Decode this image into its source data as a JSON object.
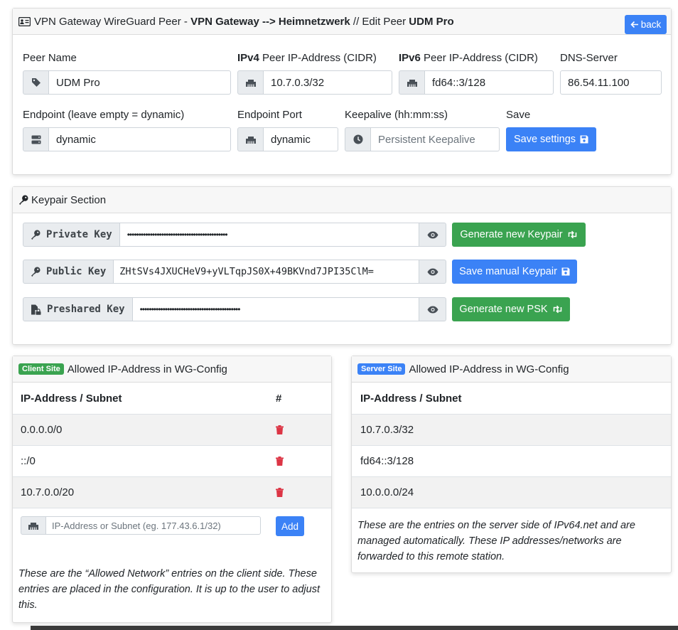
{
  "peer_card": {
    "title_prefix": "VPN Gateway WireGuard Peer - ",
    "title_gateway": "VPN Gateway --> Heimnetzwerk",
    "title_sep": " // Edit Peer ",
    "title_peer": "UDM Pro",
    "back_label": "back",
    "labels": {
      "peer_name": "Peer Name",
      "ipv4_bold": "IPv4",
      "ipv4_rest": " Peer IP-Address (CIDR)",
      "ipv6_bold": "IPv6",
      "ipv6_rest": " Peer IP-Address (CIDR)",
      "dns": "DNS-Server",
      "endpoint": "Endpoint (leave empty = dynamic)",
      "endpoint_port": "Endpoint Port",
      "keepalive": "Keepalive (hh:mm:ss)",
      "save": "Save"
    },
    "values": {
      "peer_name": "UDM Pro",
      "ipv4": "10.7.0.3/32",
      "ipv6": "fd64::3/128",
      "dns": "86.54.11.100",
      "endpoint": "dynamic",
      "endpoint_port": "dynamic",
      "keepalive_placeholder": "Persistent Keepalive"
    },
    "save_button": "Save settings"
  },
  "keypair": {
    "title": "Keypair Section",
    "private_label": "Private Key",
    "private_value": "••••••••••••••••••••••••••••••••••••••••••••",
    "public_label": "Public Key",
    "public_value": "ZHtSVs4JXUCHeV9+yVLTqpJS0X+49BKVnd7JPI35ClM=",
    "psk_label": "Preshared Key",
    "psk_value": "••••••••••••••••••••••••••••••••••••••••••••",
    "gen_keypair": "Generate new Keypair",
    "save_manual": "Save manual Keypair",
    "gen_psk": "Generate new PSK"
  },
  "client_site": {
    "badge": "Client Site",
    "title": "Allowed IP-Address in WG-Config",
    "col_ip": "IP-Address / Subnet",
    "col_action": "#",
    "rows": [
      "0.0.0.0/0",
      "::/0",
      "10.7.0.0/20"
    ],
    "input_placeholder": "IP-Address or Subnet (eg. 177.43.6.1/32)",
    "add_button": "Add",
    "note": "These are the “Allowed Network” entries on the client side. These entries are placed in the configuration. It is up to the user to adjust this."
  },
  "server_site": {
    "badge": "Server Site",
    "title": "Allowed IP-Address in WG-Config",
    "col_ip": "IP-Address / Subnet",
    "rows": [
      "10.7.0.3/32",
      "fd64::3/128",
      "10.0.0.0/24"
    ],
    "note": "These are the entries on the server side of IPv64.net and are managed automatically. These IP addresses/networks are forwarded to this remote station."
  },
  "colors": {
    "primary": "#3b82f6",
    "success": "#3aa350",
    "danger": "#dc3545"
  }
}
